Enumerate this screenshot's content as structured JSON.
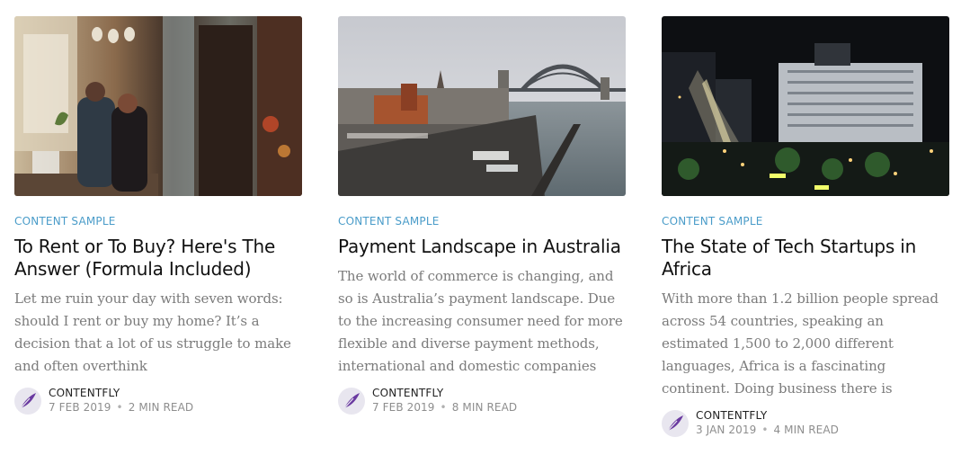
{
  "posts": [
    {
      "tag": "CONTENT SAMPLE",
      "title": "To Rent or To Buy? Here's The Answer (Formula Included)",
      "excerpt": "Let me ruin your day with seven words: should I rent or buy my home? It’s a decision that a lot of us struggle to make and often overthink",
      "author": "CONTENTFLY",
      "date": "7 FEB 2019",
      "read_time": "2 MIN READ"
    },
    {
      "tag": "CONTENT SAMPLE",
      "title": "Payment Landscape in Australia",
      "excerpt": "The world of commerce is changing, and so is Australia’s payment landscape. Due to the increasing consumer need for more flexible and diverse payment methods, international and domestic companies",
      "author": "CONTENTFLY",
      "date": "7 FEB 2019",
      "read_time": "8 MIN READ"
    },
    {
      "tag": "CONTENT SAMPLE",
      "title": "The State of Tech Startups in Africa",
      "excerpt": "With more than 1.2 billion people spread across 54 countries, speaking an estimated 1,500 to 2,000 different languages, Africa is a fascinating continent. Doing business there is",
      "author": "CONTENTFLY",
      "date": "3 JAN 2019",
      "read_time": "4 MIN READ"
    }
  ],
  "meta_separator": "•",
  "colors": {
    "tag": "#4a9cc9",
    "title": "#111111",
    "excerpt": "#7b7b7b",
    "meta": "#8e8e8e",
    "avatar_feather": "#6a3aa0"
  },
  "icons": {
    "avatar": "feather-logo-icon"
  }
}
